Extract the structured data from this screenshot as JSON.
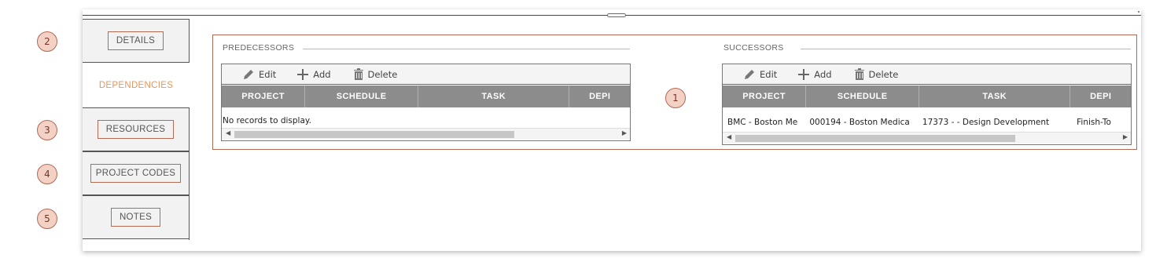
{
  "callouts": [
    "1",
    "2",
    "3",
    "4",
    "5"
  ],
  "nav": {
    "tabs": [
      {
        "label": "DETAILS",
        "active": false
      },
      {
        "label": "DEPENDENCIES",
        "active": true
      },
      {
        "label": "RESOURCES",
        "active": false
      },
      {
        "label": "PROJECT CODES",
        "active": false
      },
      {
        "label": "NOTES",
        "active": false
      }
    ]
  },
  "predecessors": {
    "title": "PREDECESSORS",
    "toolbar": {
      "edit": "Edit",
      "add": "Add",
      "delete": "Delete"
    },
    "columns": [
      "PROJECT",
      "SCHEDULE",
      "TASK",
      "DEPI"
    ],
    "empty_message": "No records to display.",
    "rows": []
  },
  "successors": {
    "title": "SUCCESSORS",
    "toolbar": {
      "edit": "Edit",
      "add": "Add",
      "delete": "Delete"
    },
    "columns": [
      "PROJECT",
      "SCHEDULE",
      "TASK",
      "DEPI"
    ],
    "rows": [
      {
        "project": "BMC - Boston Me",
        "schedule": "000194 - Boston Medica",
        "task": "17373 - - Design Development",
        "dependency": "Finish-To"
      }
    ]
  },
  "colors": {
    "accent": "#e5965a",
    "border": "#b36a55",
    "header": "#8c8c8c",
    "callout_fill": "#f3d1c5"
  },
  "icons": [
    "pencil-icon",
    "plus-icon",
    "trash-icon",
    "scroll-left-icon",
    "scroll-right-icon"
  ]
}
